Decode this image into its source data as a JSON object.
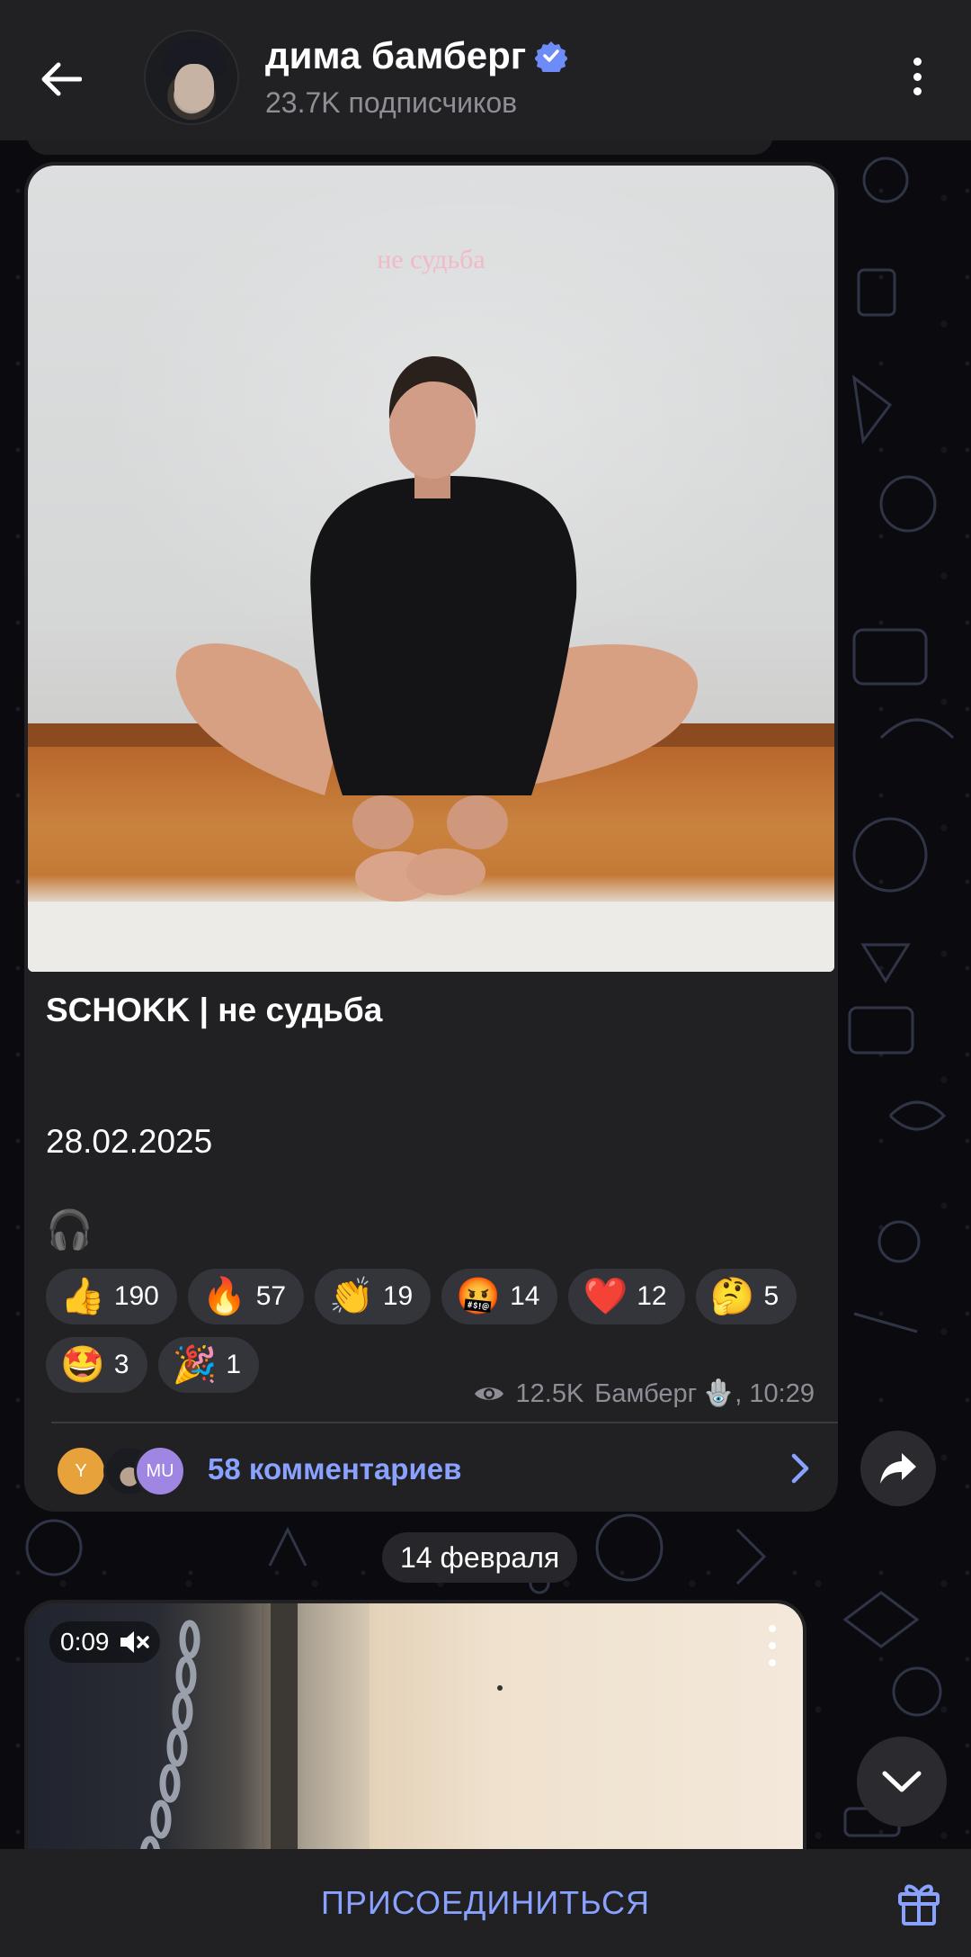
{
  "header": {
    "channel_name": "дима бамберг",
    "subscribers": "23.7K подписчиков",
    "verified": true
  },
  "post": {
    "image_caption": "не судьба",
    "title": "SCHOKK | не судьба",
    "date": "28.02.2025",
    "audio_emoji": "🎧",
    "reactions": [
      {
        "emoji": "👍",
        "count": "190"
      },
      {
        "emoji": "🔥",
        "count": "57"
      },
      {
        "emoji": "👏",
        "count": "19"
      },
      {
        "emoji": "🤬",
        "count": "14"
      },
      {
        "emoji": "❤️",
        "count": "12"
      },
      {
        "emoji": "🤔",
        "count": "5"
      },
      {
        "emoji": "🤩",
        "count": "3"
      },
      {
        "emoji": "🎉",
        "count": "1"
      }
    ],
    "views": "12.5K",
    "author": "Бамберг",
    "author_emoji": "🪬",
    "time": "10:29",
    "comment_avatars": [
      "Y",
      "",
      "MU"
    ],
    "comments_label": "58 комментариев"
  },
  "date_separator": "14 февраля",
  "video_post": {
    "duration": "0:09"
  },
  "bottom_bar": {
    "join_label": "ПРИСОЕДИНИТЬСЯ"
  },
  "colors": {
    "accent": "#8aa2ff",
    "bubble": "#212124",
    "reaction_bg": "#34343b",
    "verified": "#6e8cf7"
  }
}
